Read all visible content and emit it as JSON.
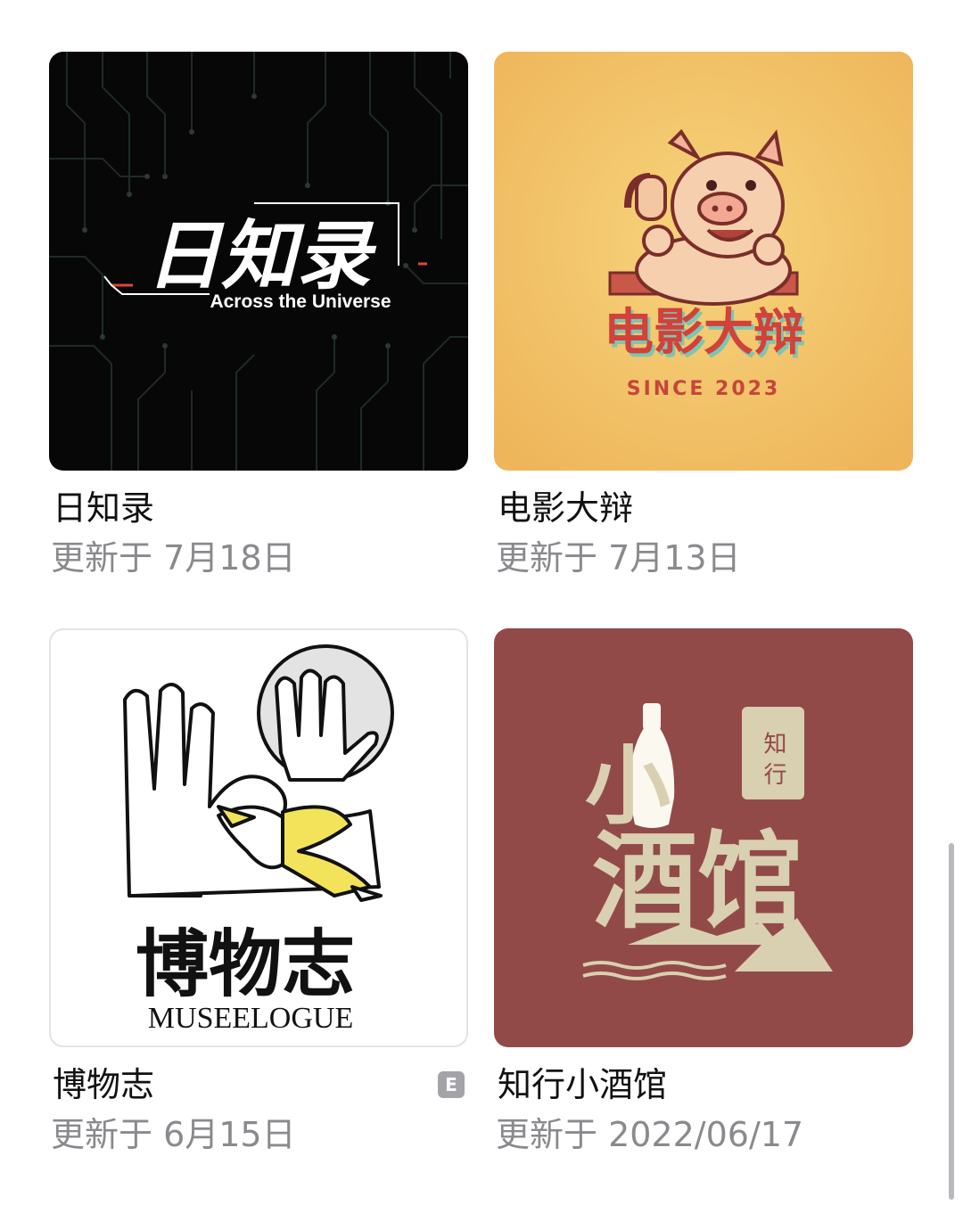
{
  "podcasts": [
    {
      "title": "日知录",
      "updated": "更新于 7月18日",
      "cover": {
        "headline": "日知录",
        "subtitle": "Across the Universe",
        "background": "#070707"
      }
    },
    {
      "title": "电影大辩",
      "updated": "更新于 7月13日",
      "cover": {
        "headline": "电影大辩",
        "subtitle": "SINCE 2023",
        "background": "#f1c161"
      }
    },
    {
      "title": "博物志",
      "updated": "更新于 6月15日",
      "explicit_badge": "E",
      "cover": {
        "headline": "博物志",
        "subtitle": "MUSEELOGUE",
        "background": "#ffffff"
      }
    },
    {
      "title": "知行小酒馆",
      "updated": "更新于 2022/06/17",
      "cover": {
        "seal": "知 行",
        "headline_top": "小",
        "headline_bottom": "酒馆",
        "background": "#924a49"
      }
    }
  ]
}
